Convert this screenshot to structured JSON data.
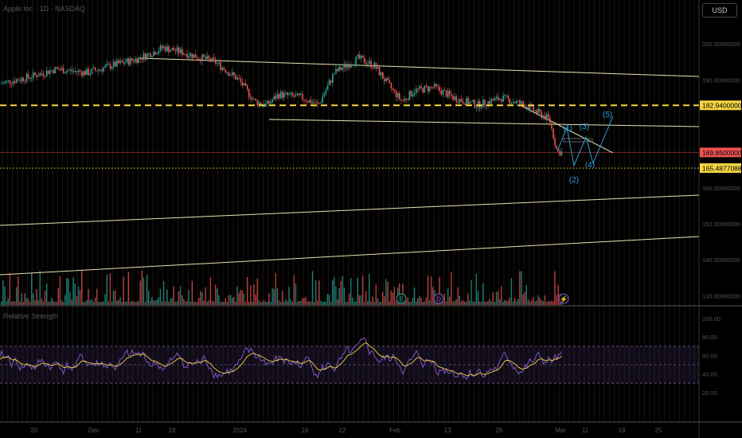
{
  "header": {
    "currency": "USD",
    "symbol_legend": "Apple Inc · 1D · NASDAQ",
    "rsi_legend": "Relative Strength"
  },
  "chart_data": [
    {
      "type": "line",
      "ylim": [
        125,
        210
      ],
      "price_ticks": [
        {
          "value": 200,
          "label": "200.00000000"
        },
        {
          "value": 190,
          "label": "190.00000000"
        },
        {
          "value": 160,
          "label": "160.00000000"
        },
        {
          "value": 150,
          "label": "150.00000000"
        },
        {
          "value": 140,
          "label": "140.00000000"
        },
        {
          "value": 130,
          "label": "130.00000000"
        }
      ],
      "price_markers": [
        {
          "name": "resistance",
          "value": 182.94,
          "label": "182.94000000",
          "color": "#f5d442",
          "style": "dashed"
        },
        {
          "name": "last-price",
          "value": 169.85,
          "label": "169.85000000",
          "color": "#ef5350",
          "style": "solid"
        },
        {
          "name": "support",
          "value": 165.4877,
          "label": "165.48770880",
          "color": "#f5d442",
          "style": "dotted"
        }
      ],
      "x_labels": [
        "20",
        "Dec",
        "11",
        "18",
        "2024",
        "16",
        "22",
        "Feb",
        "13",
        "26",
        "Mar",
        "11",
        "18",
        "25"
      ],
      "wave_labels": [
        "(1)",
        "(2)",
        "(3)",
        "(4)",
        "(5)"
      ],
      "event_markers": [
        "E",
        "D",
        "⚡"
      ],
      "colors": {
        "up": "#26a69a",
        "down": "#ef5350",
        "trend": "#e8e2b0",
        "wave": "#2a9fd6"
      }
    },
    {
      "type": "line",
      "ylim": [
        0,
        100
      ],
      "ticks": [
        "100.00",
        "80.00",
        "60.00",
        "40.00",
        "20.00"
      ],
      "bands": [
        30,
        50,
        70
      ],
      "colors": {
        "rsi": "#7e57c2",
        "ma": "#f5d442"
      }
    }
  ]
}
